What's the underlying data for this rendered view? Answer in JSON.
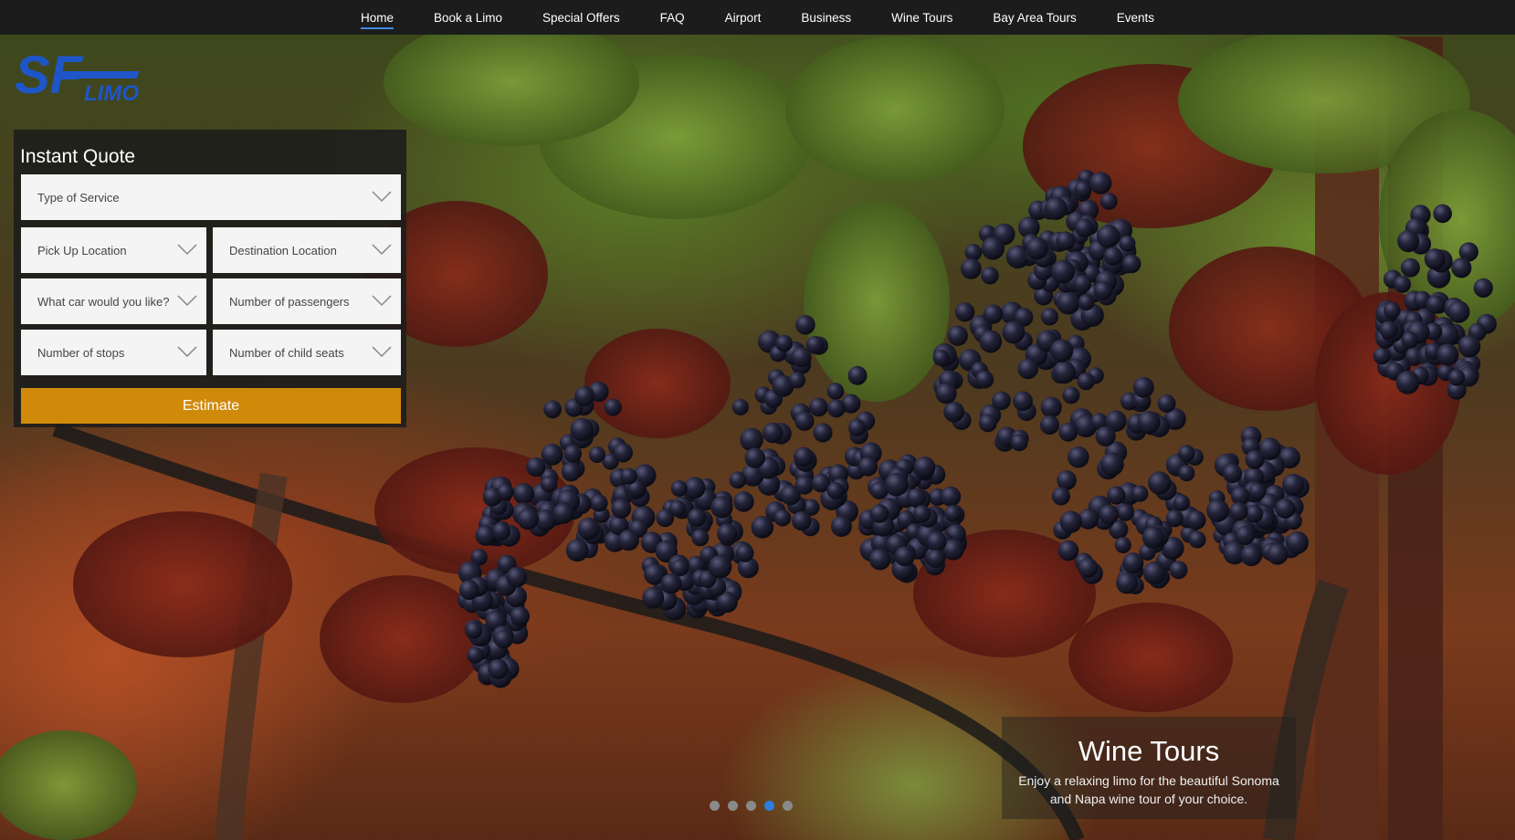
{
  "nav": {
    "items": [
      {
        "label": "Home",
        "active": true
      },
      {
        "label": "Book a Limo",
        "active": false
      },
      {
        "label": "Special Offers",
        "active": false
      },
      {
        "label": "FAQ",
        "active": false
      },
      {
        "label": "Airport",
        "active": false
      },
      {
        "label": "Business",
        "active": false
      },
      {
        "label": "Wine Tours",
        "active": false
      },
      {
        "label": "Bay Area Tours",
        "active": false
      },
      {
        "label": "Events",
        "active": false
      }
    ],
    "active_underline_color": "#3d8be0"
  },
  "logo": {
    "big_text": "SF",
    "sub_text": "LIMO",
    "color": "#1e56c8"
  },
  "quote": {
    "title": "Instant Quote",
    "type_of_service": "Type of Service",
    "pick_up_location": "Pick Up Location",
    "destination_location": "Destination Location",
    "car_choice": "What car would you like?",
    "passengers": "Number of passengers",
    "stops": "Number of stops",
    "child_seats": "Number of child seats",
    "estimate_label": "Estimate",
    "estimate_color": "#d08a0a"
  },
  "slide": {
    "title": "Wine Tours",
    "text": "Enjoy a relaxing limo for the beautiful Sonoma and Napa wine tour of your choice."
  },
  "carousel": {
    "slide_count": 5,
    "active_index": 3,
    "active_color": "#2e7de0"
  }
}
